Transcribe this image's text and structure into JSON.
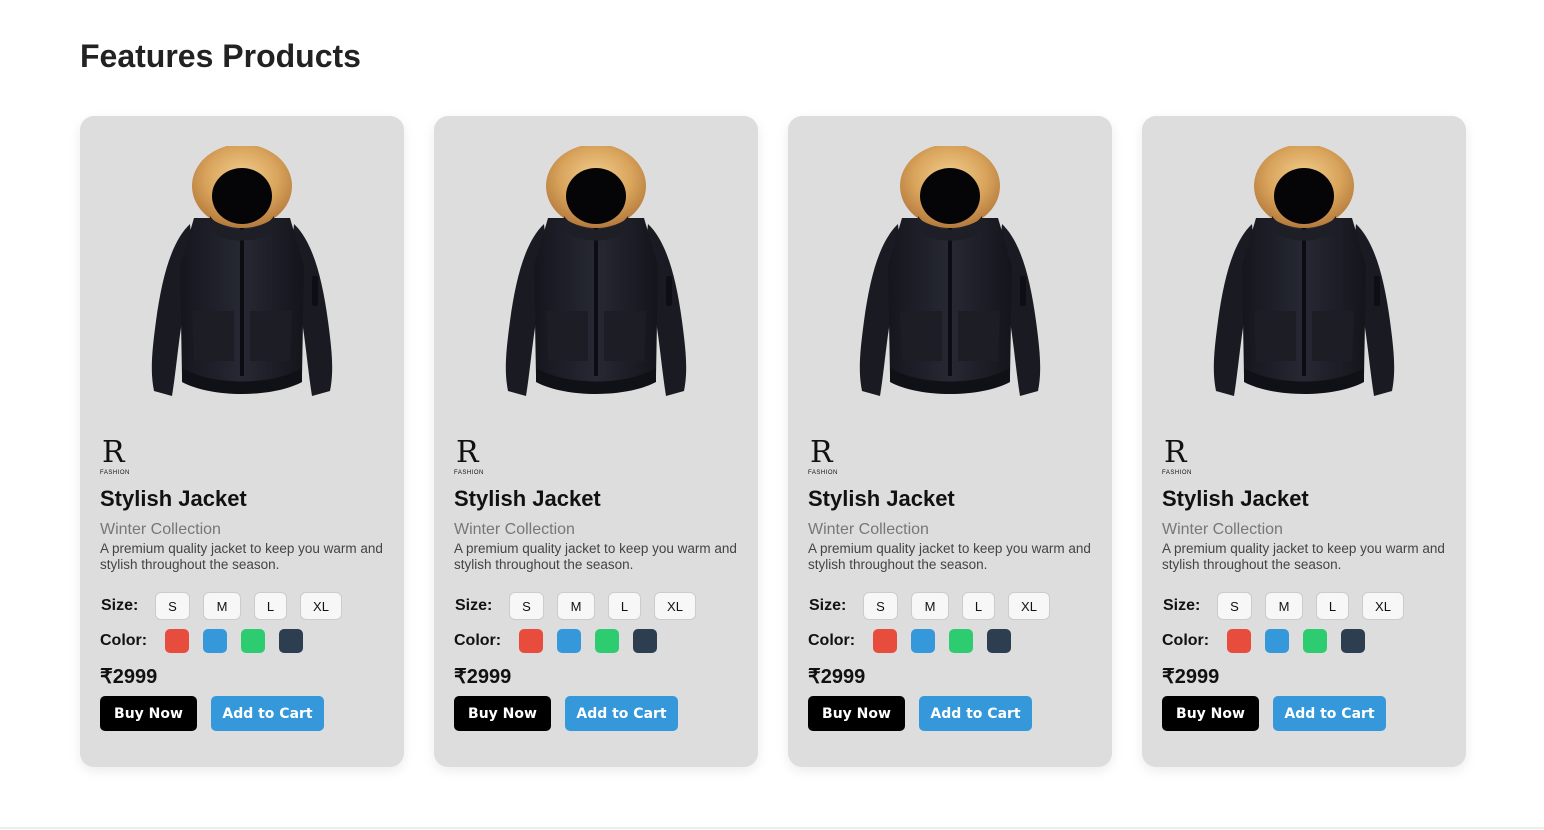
{
  "section": {
    "title": "Features Products"
  },
  "colors": {
    "card_background": "#dddddd",
    "buy_button": "#000000",
    "cart_button": "#3498db"
  },
  "products": [
    {
      "brand_letter": "R",
      "brand_word": "FASHION",
      "image_icon": "jacket-image",
      "name": "Stylish Jacket",
      "collection": "Winter Collection",
      "description": "A premium quality jacket to keep you warm and stylish throughout the season.",
      "size_label": "Size:",
      "sizes": [
        "S",
        "M",
        "L",
        "XL"
      ],
      "color_label": "Color:",
      "swatches": [
        "#e74c3c",
        "#3498db",
        "#2ecc71",
        "#2c3e50"
      ],
      "price": "₹2999",
      "buy_label": "Buy Now",
      "cart_label": "Add to Cart"
    },
    {
      "brand_letter": "R",
      "brand_word": "FASHION",
      "image_icon": "jacket-image",
      "name": "Stylish Jacket",
      "collection": "Winter Collection",
      "description": "A premium quality jacket to keep you warm and stylish throughout the season.",
      "size_label": "Size:",
      "sizes": [
        "S",
        "M",
        "L",
        "XL"
      ],
      "color_label": "Color:",
      "swatches": [
        "#e74c3c",
        "#3498db",
        "#2ecc71",
        "#2c3e50"
      ],
      "price": "₹2999",
      "buy_label": "Buy Now",
      "cart_label": "Add to Cart"
    },
    {
      "brand_letter": "R",
      "brand_word": "FASHION",
      "image_icon": "jacket-image",
      "name": "Stylish Jacket",
      "collection": "Winter Collection",
      "description": "A premium quality jacket to keep you warm and stylish throughout the season.",
      "size_label": "Size:",
      "sizes": [
        "S",
        "M",
        "L",
        "XL"
      ],
      "color_label": "Color:",
      "swatches": [
        "#e74c3c",
        "#3498db",
        "#2ecc71",
        "#2c3e50"
      ],
      "price": "₹2999",
      "buy_label": "Buy Now",
      "cart_label": "Add to Cart"
    },
    {
      "brand_letter": "R",
      "brand_word": "FASHION",
      "image_icon": "jacket-image",
      "name": "Stylish Jacket",
      "collection": "Winter Collection",
      "description": "A premium quality jacket to keep you warm and stylish throughout the season.",
      "size_label": "Size:",
      "sizes": [
        "S",
        "M",
        "L",
        "XL"
      ],
      "color_label": "Color:",
      "swatches": [
        "#e74c3c",
        "#3498db",
        "#2ecc71",
        "#2c3e50"
      ],
      "price": "₹2999",
      "buy_label": "Buy Now",
      "cart_label": "Add to Cart"
    }
  ]
}
